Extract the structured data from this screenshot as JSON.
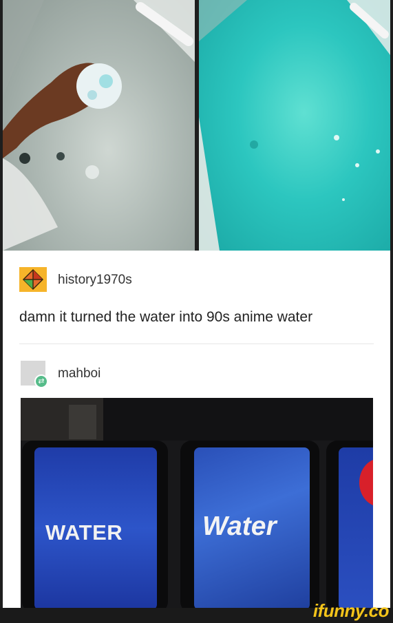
{
  "post1": {
    "username": "history1970s",
    "text": "damn it turned the water into 90s anime water"
  },
  "post2": {
    "username": "mahboi"
  },
  "vending_photo": {
    "button_left_text": "WATER",
    "button_middle_text": "Water"
  },
  "watermark": "ifunny.co",
  "colors": {
    "teal_water": "#2cc6bf",
    "reblog_green": "#56bc8a",
    "ifunny_yellow": "#f4c41a",
    "vending_blue": "#2d55c9"
  }
}
